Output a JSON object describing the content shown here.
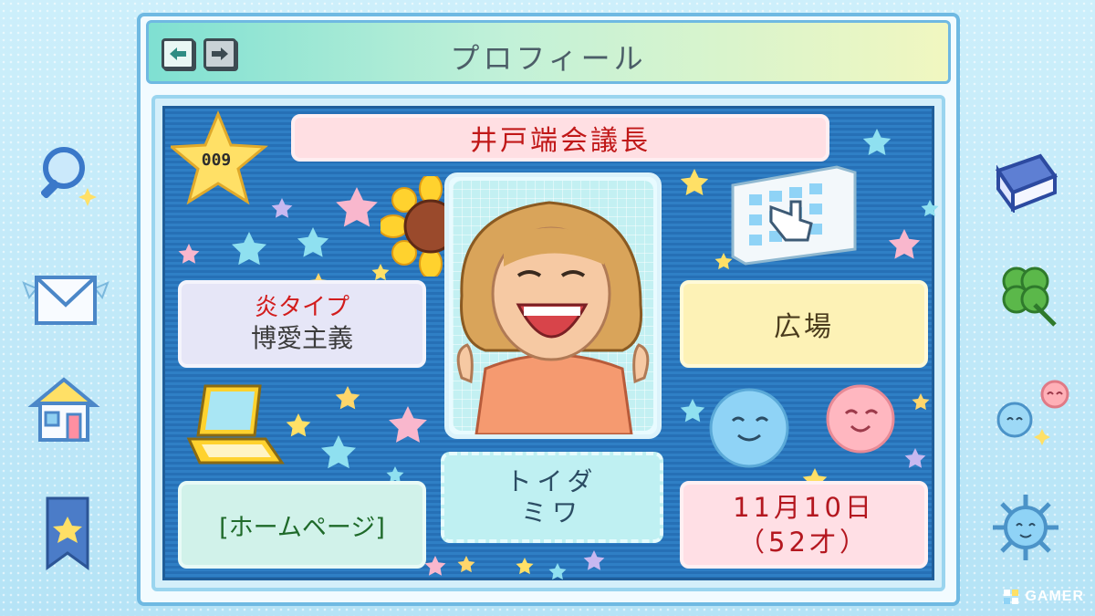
{
  "window": {
    "title": "プロフィール",
    "nav": {
      "back_icon": "arrow-left-icon",
      "forward_icon": "arrow-right-icon"
    }
  },
  "profile": {
    "number": "009",
    "name": "井戸端会議長",
    "type_label": "炎タイプ",
    "type_value": "博愛主義",
    "place": "広場",
    "homepage": "[ホームページ]",
    "kana_line1": "トイダ",
    "kana_line2": "ミワ",
    "birthday": "11月10日",
    "age": "（52才）"
  },
  "side_menu": {
    "left": [
      "search-icon",
      "mail-icon",
      "home-icon",
      "bookmark-icon"
    ],
    "right": [
      "book-icon",
      "clover-icon",
      "friends-icon",
      "virus-icon"
    ]
  },
  "watermark": {
    "text": "GAMER"
  },
  "colors": {
    "panel_blue": "#2f7fc5",
    "name_red": "#c01818",
    "accent_teal": "#7fe0d2",
    "star_yellow": "#ffe066"
  }
}
